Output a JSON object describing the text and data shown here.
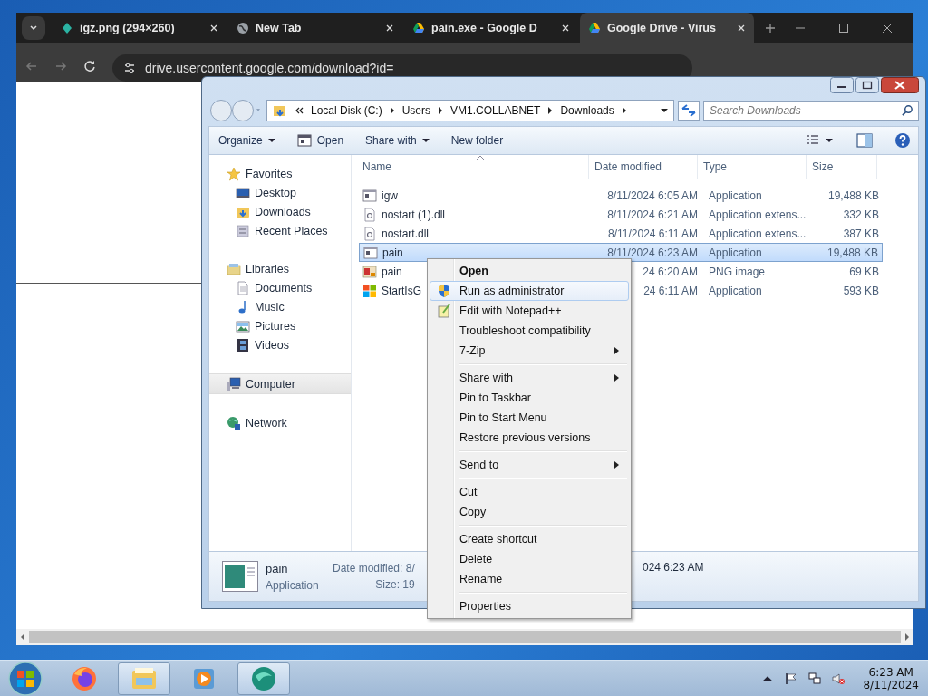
{
  "browser": {
    "tabs": [
      {
        "title": "igz.png (294×260)",
        "kind": "image",
        "selected": false
      },
      {
        "title": "New Tab",
        "kind": "globe",
        "selected": false
      },
      {
        "title": "pain.exe - Google D",
        "kind": "drive",
        "selected": false
      },
      {
        "title": "Google Drive - Virus",
        "kind": "drive",
        "selected": true
      }
    ],
    "url": "drive.usercontent.google.com/download?id="
  },
  "explorer": {
    "breadcrumb": [
      "Local Disk (C:)",
      "Users",
      "VM1.COLLABNET",
      "Downloads"
    ],
    "search": {
      "placeholder": "Search Downloads"
    },
    "toolbar": [
      {
        "label": "Organize",
        "kind": "dropdown"
      },
      {
        "label": "Open",
        "kind": "open"
      },
      {
        "label": "Share with",
        "kind": "dropdown"
      },
      {
        "label": "New folder",
        "kind": "plain"
      }
    ],
    "sidebar": [
      {
        "label": "Favorites",
        "kind": "star",
        "selected": false,
        "children": [
          {
            "label": "Desktop",
            "kind": "desktop",
            "selected": false
          },
          {
            "label": "Downloads",
            "kind": "downloads",
            "selected": false
          },
          {
            "label": "Recent Places",
            "kind": "recent",
            "selected": false
          }
        ]
      },
      {
        "label": "Libraries",
        "kind": "library",
        "selected": false,
        "children": [
          {
            "label": "Documents",
            "kind": "document",
            "selected": false
          },
          {
            "label": "Music",
            "kind": "music",
            "selected": false
          },
          {
            "label": "Pictures",
            "kind": "pictures",
            "selected": false
          },
          {
            "label": "Videos",
            "kind": "videos",
            "selected": false
          }
        ]
      },
      {
        "label": "Computer",
        "kind": "computer",
        "selected": true
      },
      {
        "label": "Network",
        "kind": "network",
        "selected": false
      }
    ],
    "columns": [
      "Name",
      "Date modified",
      "Type",
      "Size"
    ],
    "files": [
      {
        "name": "igw",
        "date": "8/11/2024 6:05 AM",
        "type": "Application",
        "size": "19,488 KB",
        "kind": "app",
        "selected": false
      },
      {
        "name": "nostart (1).dll",
        "date": "8/11/2024 6:21 AM",
        "type": "Application extens...",
        "size": "332 KB",
        "kind": "dll",
        "selected": false
      },
      {
        "name": "nostart.dll",
        "date": "8/11/2024 6:11 AM",
        "type": "Application extens...",
        "size": "387 KB",
        "kind": "dll",
        "selected": false
      },
      {
        "name": "pain",
        "date": "8/11/2024 6:23 AM",
        "type": "Application",
        "size": "19,488 KB",
        "kind": "app",
        "selected": true
      },
      {
        "name": "pain",
        "date": "24 6:20 AM",
        "type": "PNG image",
        "size": "69 KB",
        "kind": "png",
        "selected": false
      },
      {
        "name": "StartIsG",
        "date": "24 6:11 AM",
        "type": "Application",
        "size": "593 KB",
        "kind": "tiles",
        "selected": false
      }
    ],
    "details": {
      "name": "pain",
      "type": "Application",
      "date_label": "Date modified: 8/",
      "size_label": "Size: 19",
      "date_tail": "024 6:23 AM"
    }
  },
  "context_menu": [
    {
      "label": "Open",
      "kind": "default",
      "highlighted": false
    },
    {
      "label": "Run as administrator",
      "kind": "shield",
      "highlighted": true
    },
    {
      "label": "Edit with Notepad++",
      "kind": "notepad",
      "highlighted": false
    },
    {
      "label": "Troubleshoot compatibility",
      "kind": "command",
      "highlighted": false
    },
    {
      "label": "7-Zip",
      "kind": "submenu",
      "highlighted": false
    },
    {
      "kind": "separator"
    },
    {
      "label": "Share with",
      "kind": "submenu",
      "highlighted": false
    },
    {
      "label": "Pin to Taskbar",
      "kind": "command",
      "highlighted": false
    },
    {
      "label": "Pin to Start Menu",
      "kind": "command",
      "highlighted": false
    },
    {
      "label": "Restore previous versions",
      "kind": "command",
      "highlighted": false
    },
    {
      "kind": "separator"
    },
    {
      "label": "Send to",
      "kind": "submenu",
      "highlighted": false
    },
    {
      "kind": "separator"
    },
    {
      "label": "Cut",
      "kind": "command",
      "highlighted": false
    },
    {
      "label": "Copy",
      "kind": "command",
      "highlighted": false
    },
    {
      "kind": "separator"
    },
    {
      "label": "Create shortcut",
      "kind": "command",
      "highlighted": false
    },
    {
      "label": "Delete",
      "kind": "command",
      "highlighted": false
    },
    {
      "label": "Rename",
      "kind": "command",
      "highlighted": false
    },
    {
      "kind": "separator"
    },
    {
      "label": "Properties",
      "kind": "command",
      "highlighted": false
    }
  ],
  "taskbar": {
    "apps": [
      {
        "kind": "firefox",
        "active": false
      },
      {
        "kind": "folder",
        "active": true
      },
      {
        "kind": "media",
        "active": false
      },
      {
        "kind": "orb",
        "active": true
      }
    ],
    "time": "6:23 AM",
    "date": "8/11/2024"
  }
}
